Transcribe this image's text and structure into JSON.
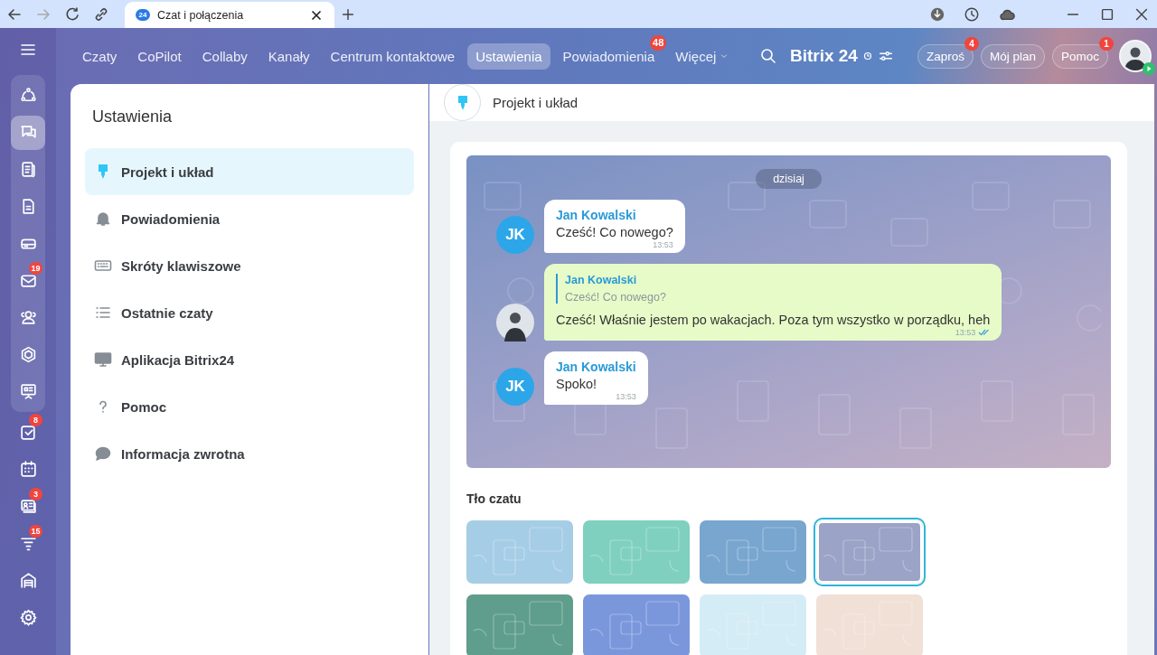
{
  "browser": {
    "tab": {
      "favicon_text": "24",
      "title": "Czat i połączenia"
    }
  },
  "header": {
    "nav": [
      {
        "label": "Czaty",
        "selected": false
      },
      {
        "label": "CoPilot",
        "selected": false
      },
      {
        "label": "Collaby",
        "selected": false
      },
      {
        "label": "Kanały",
        "selected": false
      },
      {
        "label": "Centrum kontaktowe",
        "selected": false
      },
      {
        "label": "Ustawienia",
        "selected": true
      },
      {
        "label": "Powiadomienia",
        "selected": false,
        "badge": "48"
      },
      {
        "label": "Więcej",
        "selected": false,
        "dropdown": true
      }
    ],
    "logo": "Bitrix",
    "logo_number": "24",
    "buttons": [
      {
        "label": "Zaproś",
        "badge": "4"
      },
      {
        "label": "Mój plan"
      },
      {
        "label": "Pomoc",
        "badge": "1"
      }
    ]
  },
  "rail": {
    "pinned": [
      {
        "selected": false
      },
      {
        "selected": true
      },
      {
        "selected": false
      },
      {
        "selected": false
      },
      {
        "selected": false
      },
      {
        "selected": false,
        "badge": "19"
      },
      {
        "selected": false
      },
      {
        "selected": false
      },
      {
        "selected": false
      }
    ],
    "items": [
      {
        "selected": false,
        "badge": "8"
      },
      {
        "selected": false
      },
      {
        "selected": false,
        "badge": "3"
      },
      {
        "selected": false,
        "badge": "15"
      },
      {
        "selected": false
      },
      {
        "selected": false
      }
    ]
  },
  "settings": {
    "title": "Ustawienia",
    "items": [
      {
        "label": "Projekt i układ",
        "selected": true
      },
      {
        "label": "Powiadomienia",
        "selected": false
      },
      {
        "label": "Skróty klawiszowe",
        "selected": false
      },
      {
        "label": "Ostatnie czaty",
        "selected": false
      },
      {
        "label": "Aplikacja Bitrix24",
        "selected": false
      },
      {
        "label": "Pomoc",
        "selected": false
      },
      {
        "label": "Informacja zwrotna",
        "selected": false
      }
    ]
  },
  "panel": {
    "title": "Projekt i układ",
    "preview": {
      "date": "dzisiaj",
      "messages": [
        {
          "kind": "incoming",
          "avatar": "JK",
          "author": "Jan Kowalski",
          "text": "Cześć! Co nowego?",
          "time": "13:53"
        },
        {
          "kind": "outgoing",
          "quote": {
            "author": "Jan Kowalski",
            "text": "Cześć! Co nowego?"
          },
          "text": "Cześć! Właśnie jestem po wakacjach. Poza tym wszystko w porządku, heh",
          "time": "13:53",
          "read": true
        },
        {
          "kind": "incoming",
          "avatar": "JK",
          "author": "Jan Kowalski",
          "text": "Spoko!",
          "time": "13:53"
        }
      ]
    },
    "background": {
      "title": "Tło czatu",
      "swatches": [
        {
          "color": "#a6cde6",
          "selected": false
        },
        {
          "color": "#7fd0bf",
          "selected": false
        },
        {
          "color": "#78a6cf",
          "selected": false
        },
        {
          "color": "#9ba3c6",
          "selected": true
        },
        {
          "color": "#5f9e8c",
          "selected": false
        },
        {
          "color": "#7b97dc",
          "selected": false
        },
        {
          "color": "#d4ecf6",
          "selected": false
        },
        {
          "color": "#f1e0d6",
          "selected": false
        }
      ]
    }
  }
}
